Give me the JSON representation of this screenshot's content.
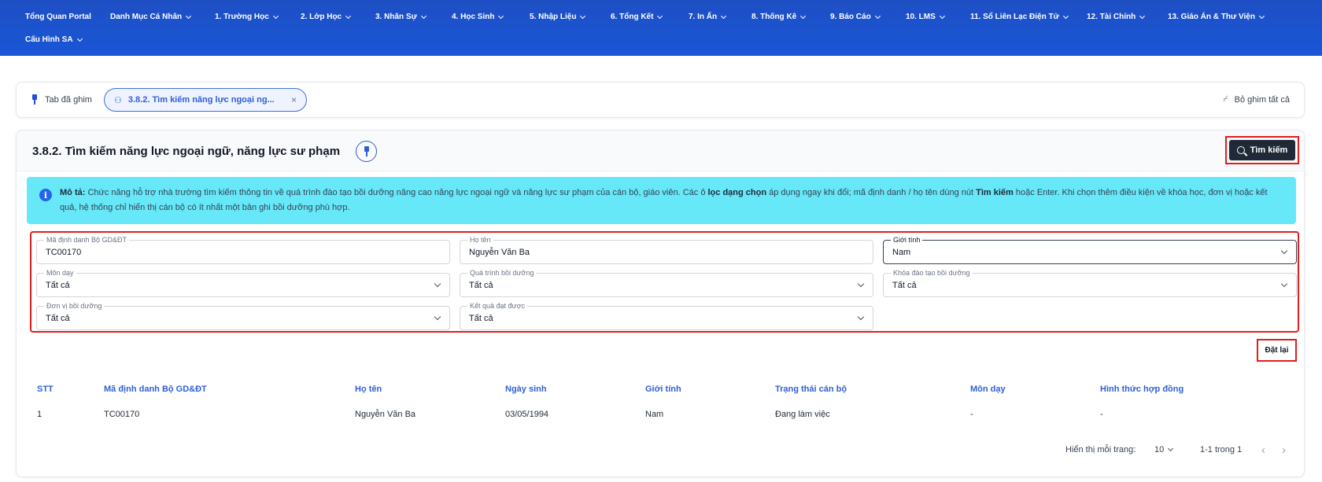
{
  "nav": {
    "items": [
      {
        "label": "Tổng Quan Portal",
        "dropdown": false
      },
      {
        "label": "Danh Mục Cá Nhân",
        "dropdown": true
      },
      {
        "label": "1. Trường Học",
        "dropdown": true
      },
      {
        "label": "2. Lớp Học",
        "dropdown": true
      },
      {
        "label": "3. Nhân Sự",
        "dropdown": true
      },
      {
        "label": "4. Học Sinh",
        "dropdown": true
      },
      {
        "label": "5. Nhập Liệu",
        "dropdown": true
      },
      {
        "label": "6. Tổng Kết",
        "dropdown": true
      },
      {
        "label": "7. In Ấn",
        "dropdown": true
      },
      {
        "label": "8. Thống Kê",
        "dropdown": true
      },
      {
        "label": "9. Báo Cáo",
        "dropdown": true
      },
      {
        "label": "10. LMS",
        "dropdown": true
      },
      {
        "label": "11. Sổ Liên Lạc Điện Tử",
        "dropdown": true
      },
      {
        "label": "12. Tài Chính",
        "dropdown": true
      },
      {
        "label": "13. Giáo Án & Thư Viện",
        "dropdown": true
      },
      {
        "label": "Cấu Hình SA",
        "dropdown": true
      }
    ]
  },
  "pinned": {
    "label": "Tab đã ghim",
    "tab_label": "3.8.2. Tìm kiếm năng lực ngoại ng...",
    "unpin_all": "Bỏ ghim tất cả"
  },
  "page": {
    "title": "3.8.2. Tìm kiếm năng lực ngoại ngữ, năng lực sư phạm",
    "search_button": "Tìm kiếm",
    "reset_button": "Đặt lại"
  },
  "description": {
    "lead": "Mô tả:",
    "part1": " Chức năng hỗ trợ nhà trường tìm kiếm thông tin về quá trình đào tạo bồi dưỡng nâng cao năng lực ngoại ngữ và năng lực sư phạm của cán bộ, giáo viên. Các ô ",
    "bold1": "lọc dạng chọn",
    "part2": " áp dụng ngay khi đổi; mã định danh / họ tên dùng nút ",
    "bold2": "Tìm kiếm",
    "part3": " hoặc Enter. Khi chọn thêm điều kiện về khóa học, đơn vị hoặc kết quả, hệ thống chỉ hiển thị cán bộ có ít nhất một bản ghi bồi dưỡng phù hợp."
  },
  "filters": {
    "ma_dinh_danh": {
      "label": "Mã định danh Bộ GD&ĐT",
      "value": "TC00170"
    },
    "ho_ten": {
      "label": "Họ tên",
      "value": "Nguyễn Văn Ba"
    },
    "gioi_tinh": {
      "label": "Giới tính",
      "value": "Nam"
    },
    "mon_day": {
      "label": "Môn dạy",
      "value": "Tất cả"
    },
    "qua_trinh": {
      "label": "Quá trình bồi dưỡng",
      "value": "Tất cả"
    },
    "khoa_dao_tao": {
      "label": "Khóa đào tạo bồi dưỡng",
      "value": "Tất cả"
    },
    "don_vi": {
      "label": "Đơn vị bồi dưỡng",
      "value": "Tất cả"
    },
    "ket_qua": {
      "label": "Kết quả đạt được",
      "value": "Tất cả"
    }
  },
  "table": {
    "headers": [
      "STT",
      "Mã định danh Bộ GD&ĐT",
      "Họ tên",
      "Ngày sinh",
      "Giới tính",
      "Trạng thái cán bộ",
      "Môn dạy",
      "Hình thức hợp đồng"
    ],
    "rows": [
      [
        "1",
        "TC00170",
        "Nguyễn Văn Ba",
        "03/05/1994",
        "Nam",
        "Đang làm việc",
        "-",
        "-"
      ]
    ]
  },
  "pagination": {
    "per_page_label": "Hiển thị mỗi trang:",
    "per_page_value": "10",
    "range": "1-1 trong 1",
    "prev": "‹",
    "next": "›"
  }
}
